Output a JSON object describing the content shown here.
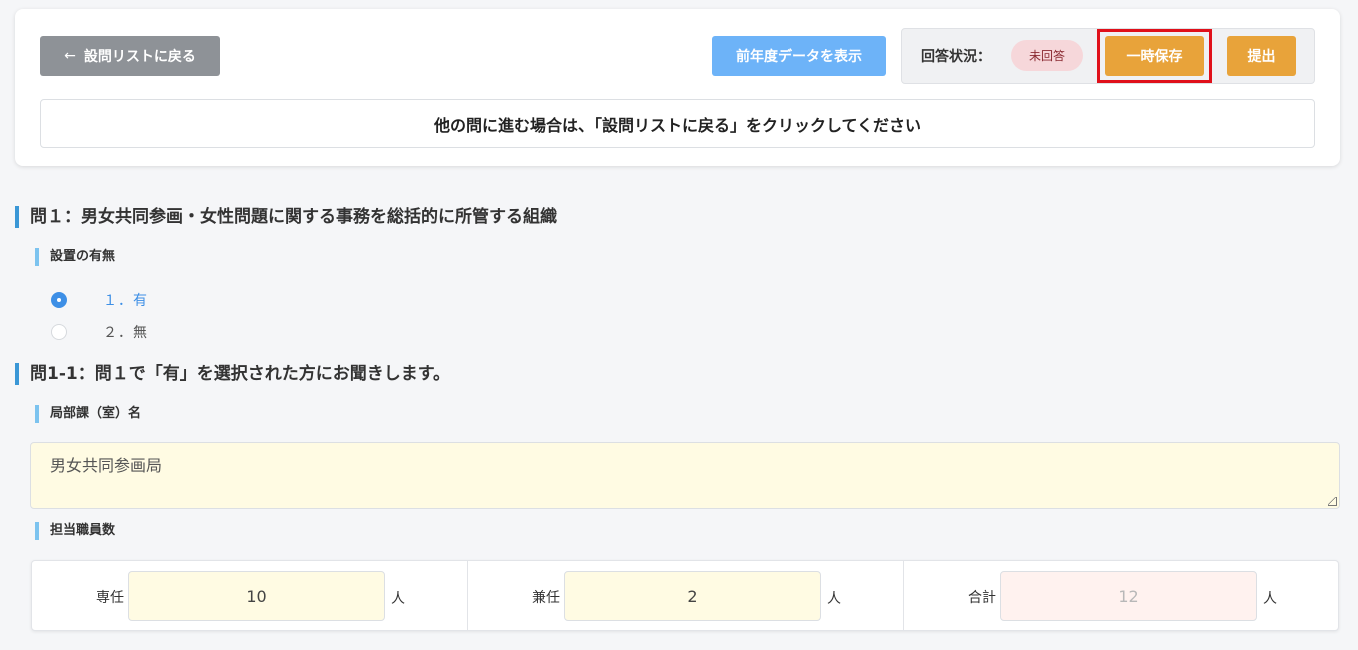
{
  "header": {
    "back_arrow": "←",
    "back_label": "設問リストに戻る",
    "prev_year_label": "前年度データを表示",
    "status_label": "回答状況：",
    "status_badge": "未回答",
    "save_label": "一時保存",
    "submit_label": "提出",
    "notice": "他の問に進む場合は、「設問リストに戻る」をクリックしてください"
  },
  "q1": {
    "title": "問１：男女共同参画・女性問題に関する事務を総括的に所管する組織",
    "sub_title": "設置の有無",
    "options": [
      {
        "label": "１．有",
        "checked": true
      },
      {
        "label": "２．無",
        "checked": false
      }
    ]
  },
  "q1_1": {
    "title": "問1-1：問１で「有」を選択された方にお聞きします。",
    "dept_label": "局部課（室）名",
    "dept_value": "男女共同参画局",
    "staff_label": "担当職員数",
    "staff": [
      {
        "label": "専任",
        "value": "10",
        "unit": "人"
      },
      {
        "label": "兼任",
        "value": "2",
        "unit": "人"
      },
      {
        "label": "合計",
        "value": "12",
        "unit": "人"
      }
    ]
  },
  "colors": {
    "accent_blue": "#3d8fe6",
    "save_orange": "#e8a33a",
    "highlight_red": "#e0101a",
    "input_yellow": "#fffbe3"
  }
}
